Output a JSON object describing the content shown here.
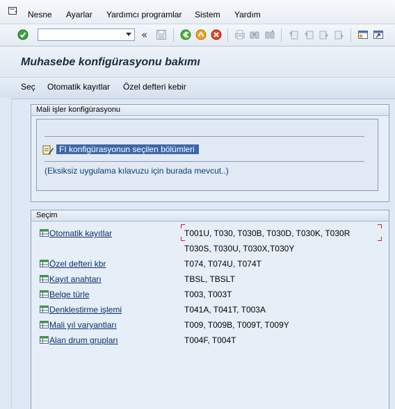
{
  "menubar": {
    "items": [
      "Nesne",
      "Ayarlar",
      "Yardımcı programlar",
      "Sistem",
      "Yardım"
    ]
  },
  "toolbar": {
    "command_field_value": "",
    "icons": [
      "enter-icon",
      "back-icon",
      "exit-icon",
      "cancel-icon",
      "print-icon",
      "find-icon",
      "find-next-icon",
      "first-page-icon",
      "previous-page-icon",
      "next-page-icon",
      "last-page-icon",
      "new-session-icon",
      "shortcut-icon",
      "save-icon"
    ]
  },
  "header": {
    "title": "Muhasebe konfigürasyonu bakımı"
  },
  "appbar": {
    "items": [
      "Seç",
      "Otomatik kayıtlar",
      "Özel defteri kebir"
    ]
  },
  "fi_group": {
    "title": "Mali işler konfigürasyonu",
    "link": "FI konfigürasyonun seçilen bölümleri",
    "hint": "(Eksiksiz uygulama kılavuzu için burada mevcut..)"
  },
  "selection_group": {
    "title": "Seçim",
    "rows": [
      {
        "label": "Otomatik kayıtlar",
        "tables": "T001U, T030,  T030B, T030D, T030K, T030R",
        "tables_line2": "T030S, T030U, T030X,T030Y"
      },
      {
        "label": "Özel defteri kbr",
        "tables": "T074,  T074U, T074T"
      },
      {
        "label": "Kayıt anahtarı",
        "tables": "TBSL,  TBSLT"
      },
      {
        "label": "Belge türle",
        "tables": "T003,  T003T"
      },
      {
        "label": "Denklestirme işlemi",
        "tables": "T041A, T041T, T003A"
      },
      {
        "label": "Mali yıl varyantları",
        "tables": "T009,  T009B, T009T, T009Y"
      },
      {
        "label": "Alan drum grupları",
        "tables": "T004F, T004T"
      }
    ]
  }
}
